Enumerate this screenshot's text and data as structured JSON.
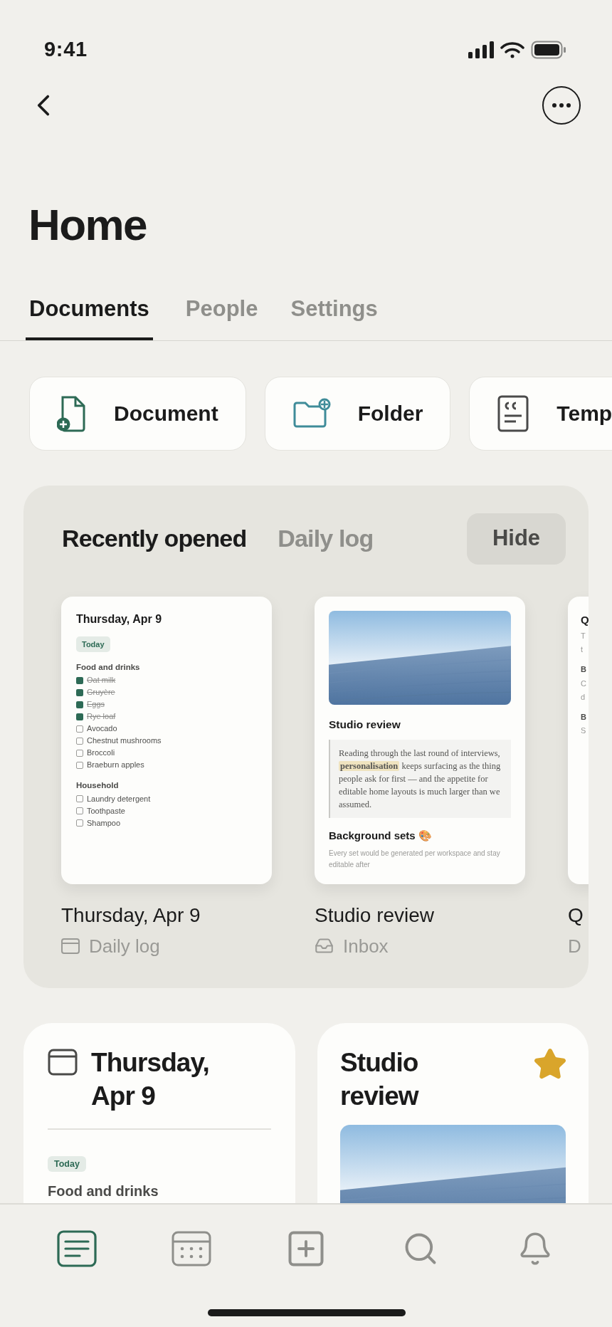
{
  "status_bar": {
    "time": "9:41"
  },
  "title": "Home",
  "tabs": [
    {
      "label": "Documents",
      "selected": true
    },
    {
      "label": "People",
      "selected": false
    },
    {
      "label": "Settings",
      "selected": false
    }
  ],
  "quick_actions": [
    {
      "label": "Document",
      "kind": "document"
    },
    {
      "label": "Folder",
      "kind": "folder"
    },
    {
      "label": "Temp",
      "kind": "template"
    }
  ],
  "recent": {
    "tabs": [
      {
        "label": "Recently opened",
        "selected": true
      },
      {
        "label": "Daily log",
        "selected": false
      }
    ],
    "hide_button": "Hide",
    "items": [
      {
        "kind": "checklist",
        "name": "Thursday, Apr 9",
        "location": {
          "label": "Daily log",
          "kind": "daily"
        },
        "preview": {
          "title": "Thursday, Apr 9",
          "tag": "Today",
          "sections": [
            {
              "heading": "Food and drinks",
              "items": [
                {
                  "text": "Oat milk",
                  "checked": true
                },
                {
                  "text": "Gruyère",
                  "checked": true
                },
                {
                  "text": "Eggs",
                  "checked": true
                },
                {
                  "text": "Rye loaf",
                  "checked": true
                },
                {
                  "text": "Avocado",
                  "checked": false
                },
                {
                  "text": "Chestnut mushrooms",
                  "checked": false
                },
                {
                  "text": "Broccoli",
                  "checked": false
                },
                {
                  "text": "Braeburn apples",
                  "checked": false
                }
              ]
            },
            {
              "heading": "Household",
              "items": [
                {
                  "text": "Laundry detergent",
                  "checked": false
                },
                {
                  "text": "Toothpaste",
                  "checked": false
                },
                {
                  "text": "Shampoo",
                  "checked": false
                }
              ]
            }
          ]
        }
      },
      {
        "kind": "note",
        "name": "Studio review",
        "location": {
          "label": "Inbox",
          "kind": "inbox"
        },
        "preview": {
          "title": "Studio review",
          "quote": "Reading through the last round of interviews, **personalisation** keeps surfacing as the thing people ask for first — and the appetite for editable home layouts is much larger than we assumed.",
          "subheading": "Background sets 🎨",
          "caption": "Every set would be generated per workspace and stay editable after"
        }
      },
      {
        "kind": "outline",
        "name": "Q",
        "location": {
          "label": "D",
          "kind": "none"
        },
        "preview": {
          "title": "Q",
          "lines": [
            {
              "kind": "body",
              "text": "T"
            },
            {
              "kind": "body",
              "text": "t"
            },
            {
              "kind": "heading",
              "text": "B"
            },
            {
              "kind": "body",
              "text": "C"
            },
            {
              "kind": "body",
              "text": "d"
            },
            {
              "kind": "heading",
              "text": "B"
            },
            {
              "kind": "body",
              "text": "S"
            }
          ]
        }
      }
    ]
  },
  "pinned": [
    {
      "kind": "daily",
      "title": "Thursday, Apr 9",
      "tag": "Today",
      "section": "Food and drinks",
      "starred": false
    },
    {
      "kind": "note",
      "title": "Studio review",
      "starred": true
    }
  ],
  "bottom_nav": [
    {
      "kind": "documents",
      "selected": true
    },
    {
      "kind": "calendar",
      "selected": false
    },
    {
      "kind": "new",
      "selected": false
    },
    {
      "kind": "search",
      "selected": false
    },
    {
      "kind": "notifications",
      "selected": false
    }
  ]
}
